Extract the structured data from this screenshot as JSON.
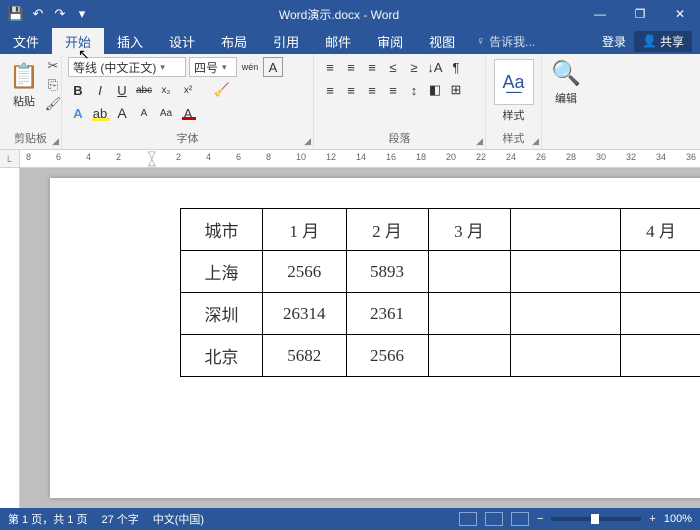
{
  "title": "Word演示.docx - Word",
  "qat": {
    "save": "💾",
    "undo": "↶",
    "redo": "↷",
    "custom": "▾"
  },
  "window": {
    "min": "—",
    "max": "❐",
    "close": "✕"
  },
  "menu": {
    "file": "文件",
    "home": "开始",
    "insert": "插入",
    "design": "设计",
    "layout": "布局",
    "references": "引用",
    "mail": "邮件",
    "review": "审阅",
    "view": "视图",
    "tell_icon": "♀",
    "tell": "告诉我...",
    "login": "登录",
    "share": "共享",
    "share_icon": "👤"
  },
  "ribbon": {
    "clipboard": {
      "paste": "粘贴",
      "paste_icon": "📋",
      "cut": "✂",
      "copy": "⎘",
      "painter": "🖌",
      "label": "剪贴板"
    },
    "font": {
      "name": "等线 (中文正文)",
      "size": "四号",
      "pinyin": "wén",
      "charborder": "A",
      "bold": "B",
      "italic": "I",
      "underline": "U",
      "strike": "abc",
      "sub": "x₂",
      "sup": "x²",
      "clear": "🧹",
      "effects": "A",
      "highlight": "ab",
      "grow": "A",
      "shrink": "A",
      "changecase": "Aa",
      "color": "A",
      "label": "字体"
    },
    "paragraph": {
      "bullets": "≡",
      "numbering": "≡",
      "multilevel": "≡",
      "indent_dec": "≤",
      "indent_inc": "≥",
      "sort": "↓A",
      "marks": "¶",
      "align_l": "≡",
      "align_c": "≡",
      "align_r": "≡",
      "align_j": "≡",
      "spacing": "↕",
      "shading": "◧",
      "borders": "⊞",
      "label": "段落"
    },
    "styles": {
      "icon": "A͟a",
      "label": "样式"
    },
    "editing": {
      "icon": "🔍",
      "label": "编辑"
    }
  },
  "ruler": {
    "corner": "L",
    "marks": [
      "8",
      "6",
      "4",
      "2",
      "",
      "2",
      "4",
      "6",
      "8",
      "10",
      "12",
      "14",
      "16",
      "18",
      "20",
      "22",
      "24",
      "26",
      "28",
      "30",
      "32",
      "34",
      "36"
    ]
  },
  "table": {
    "headers": [
      "城市",
      "1 月",
      "2 月",
      "3 月",
      "",
      "4 月"
    ],
    "rows": [
      [
        "上海",
        "2566",
        "5893",
        "",
        "",
        ""
      ],
      [
        "深圳",
        "26314",
        "2361",
        "",
        "",
        ""
      ],
      [
        "北京",
        "5682",
        "2566",
        "",
        "",
        ""
      ]
    ]
  },
  "status": {
    "page": "第 1 页，共 1 页",
    "words": "27 个字",
    "lang": "中文(中国)",
    "zoom": "100%",
    "minus": "−",
    "plus": "+"
  }
}
